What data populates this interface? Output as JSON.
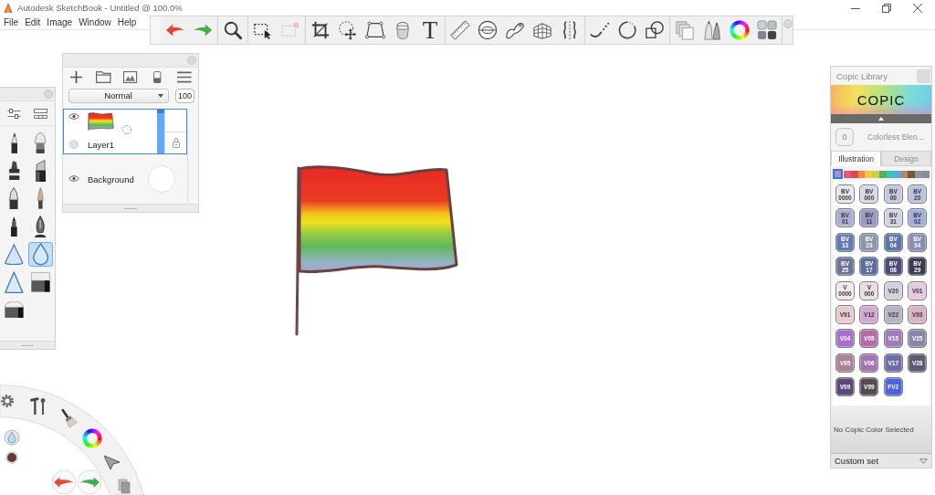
{
  "window": {
    "title": "Autodesk SketchBook - Untitled @ 100.0%"
  },
  "menu": [
    "File",
    "Edit",
    "Image",
    "Window",
    "Help"
  ],
  "toolbar": {
    "groups": [
      [
        {
          "kind": "undo",
          "disabled": false
        },
        {
          "kind": "redo",
          "disabled": false
        }
      ],
      [
        {
          "kind": "zoom",
          "disabled": false
        }
      ],
      [
        {
          "kind": "select",
          "disabled": false
        },
        {
          "kind": "clear_selection",
          "disabled": true
        }
      ],
      [
        {
          "kind": "crop",
          "disabled": false
        },
        {
          "kind": "transform",
          "disabled": false
        },
        {
          "kind": "distort",
          "disabled": false
        },
        {
          "kind": "fill",
          "disabled": false
        },
        {
          "kind": "text",
          "disabled": false,
          "label": "T"
        }
      ],
      [
        {
          "kind": "ruler",
          "disabled": false
        },
        {
          "kind": "ellipse",
          "disabled": false
        },
        {
          "kind": "french_curve",
          "disabled": false
        },
        {
          "kind": "perspective",
          "disabled": false
        },
        {
          "kind": "symmetry",
          "disabled": false
        }
      ],
      [
        {
          "kind": "stroke",
          "disabled": false
        },
        {
          "kind": "circle",
          "disabled": false
        },
        {
          "kind": "shape",
          "disabled": false
        }
      ],
      [
        {
          "kind": "copy",
          "disabled": false
        },
        {
          "kind": "brushes",
          "disabled": false
        },
        {
          "kind": "color",
          "disabled": false
        },
        {
          "kind": "palette",
          "disabled": false
        }
      ]
    ]
  },
  "layers_panel": {
    "blend_mode": "Normal",
    "opacity": "100",
    "layers": [
      {
        "name": "Layer1",
        "kind": "paint",
        "selected": true,
        "visible": true
      },
      {
        "name": "Background",
        "kind": "background",
        "selected": false,
        "visible": true
      }
    ]
  },
  "brush_palette": {
    "brushes": [
      {
        "kind": "pencil",
        "selected": false
      },
      {
        "kind": "airbrush",
        "selected": false
      },
      {
        "kind": "marker",
        "selected": false
      },
      {
        "kind": "chisel_marker",
        "selected": false
      },
      {
        "kind": "pen",
        "selected": false
      },
      {
        "kind": "paintbrush",
        "selected": false
      },
      {
        "kind": "felt_pen",
        "selected": false
      },
      {
        "kind": "nib",
        "selected": false
      },
      {
        "kind": "cone",
        "selected": false
      },
      {
        "kind": "drop",
        "selected": true
      },
      {
        "kind": "triangle",
        "selected": false
      },
      {
        "kind": "eraser",
        "selected": false
      },
      {
        "kind": "rounded_eraser",
        "selected": false
      }
    ]
  },
  "copic_library": {
    "title": "Copic Library",
    "logo": "COPIC",
    "blender": {
      "value": "0",
      "label": "Colorless Blen..."
    },
    "tabs": [
      {
        "label": "Illustration",
        "selected": true
      },
      {
        "label": "Design",
        "selected": false
      }
    ],
    "families": [
      {
        "color": "#a58fcc",
        "selected": true
      },
      {
        "color": "#e8557a",
        "selected": false
      },
      {
        "color": "#e2474d",
        "selected": false
      },
      {
        "color": "#f08b3c",
        "selected": false
      },
      {
        "color": "#f5c842",
        "selected": false
      },
      {
        "color": "#c4d448",
        "selected": false
      },
      {
        "color": "#53b553",
        "selected": false
      },
      {
        "color": "#3cc2c2",
        "selected": false
      },
      {
        "color": "#5aa9e0",
        "selected": false
      },
      {
        "color": "#b08a62",
        "selected": false
      },
      {
        "color": "#7a5640",
        "selected": false
      },
      {
        "color": "#8797a6",
        "selected": false
      },
      {
        "color": "#8c8c8c",
        "selected": false
      }
    ],
    "swatches": [
      {
        "label": "BV 0000",
        "color": "#e6e6ee"
      },
      {
        "label": "BV 000",
        "color": "#d9d8ea"
      },
      {
        "label": "BV 00",
        "color": "#c5c6df"
      },
      {
        "label": "BV 20",
        "color": "#b9c3e0"
      },
      {
        "label": "BV 01",
        "color": "#a9afd6"
      },
      {
        "label": "BV 11",
        "color": "#9c9ac6"
      },
      {
        "label": "BV 31",
        "color": "#d2d4e6"
      },
      {
        "label": "BV 02",
        "color": "#a3b0dd"
      },
      {
        "label": "BV 13",
        "color": "#6179b7"
      },
      {
        "label": "BV 23",
        "color": "#8b96ae"
      },
      {
        "label": "BV 04",
        "color": "#5b74ab"
      },
      {
        "label": "BV 34",
        "color": "#878db5"
      },
      {
        "label": "BV 25",
        "color": "#6b7495"
      },
      {
        "label": "BV 17",
        "color": "#5a6ba6"
      },
      {
        "label": "BV 08",
        "color": "#4c4b78"
      },
      {
        "label": "BV 29",
        "color": "#3b3a4f"
      },
      {
        "label": "V 0000",
        "color": "#f2e9eb"
      },
      {
        "label": "V 000",
        "color": "#ecdde3"
      },
      {
        "label": "V20",
        "color": "#d3d1dc"
      },
      {
        "label": "V01",
        "color": "#e6c9df"
      },
      {
        "label": "V91",
        "color": "#e7cbcf"
      },
      {
        "label": "V12",
        "color": "#d3a9d3"
      },
      {
        "label": "V22",
        "color": "#b4b4c4"
      },
      {
        "label": "V93",
        "color": "#d9b2c5"
      },
      {
        "label": "V04",
        "color": "#a76fcd"
      },
      {
        "label": "V05",
        "color": "#b66ba7"
      },
      {
        "label": "V15",
        "color": "#9f7bb8"
      },
      {
        "label": "V25",
        "color": "#8984a9"
      },
      {
        "label": "V95",
        "color": "#a98395"
      },
      {
        "label": "V06",
        "color": "#a473b1"
      },
      {
        "label": "V17",
        "color": "#6f6fa8"
      },
      {
        "label": "V28",
        "color": "#5c5a74"
      },
      {
        "label": "V09",
        "color": "#5c4779"
      },
      {
        "label": "V99",
        "color": "#5a4853"
      },
      {
        "label": "FV2",
        "color": "#4d62dc"
      }
    ],
    "status": "No Copic Color Selected",
    "set": "Custom set"
  }
}
